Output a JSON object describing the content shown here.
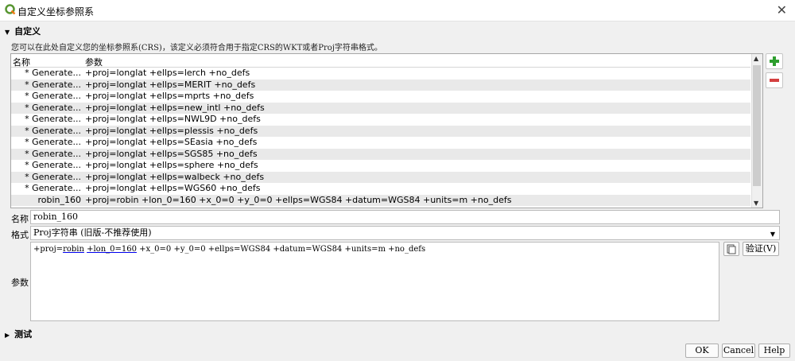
{
  "window": {
    "title": "自定义坐标参照系",
    "close_icon": "close-icon"
  },
  "section": {
    "label": "自定义",
    "description": "您可以在此处自定义您的坐标参照系(CRS)，该定义必须符合用于指定CRS的WKT或者Proj字符串格式。"
  },
  "table": {
    "headers": {
      "name": "名称",
      "params": "参数"
    },
    "rows": [
      {
        "name": "* Generate...",
        "params": "+proj=longlat +ellps=lerch +no_defs"
      },
      {
        "name": "* Generate...",
        "params": "+proj=longlat +ellps=MERIT +no_defs"
      },
      {
        "name": "* Generate...",
        "params": "+proj=longlat +ellps=mprts +no_defs"
      },
      {
        "name": "* Generate...",
        "params": "+proj=longlat +ellps=new_intl +no_defs"
      },
      {
        "name": "* Generate...",
        "params": "+proj=longlat +ellps=NWL9D +no_defs"
      },
      {
        "name": "* Generate...",
        "params": "+proj=longlat +ellps=plessis +no_defs"
      },
      {
        "name": "* Generate...",
        "params": "+proj=longlat +ellps=SEasia +no_defs"
      },
      {
        "name": "* Generate...",
        "params": "+proj=longlat +ellps=SGS85 +no_defs"
      },
      {
        "name": "* Generate...",
        "params": "+proj=longlat +ellps=sphere +no_defs"
      },
      {
        "name": "* Generate...",
        "params": "+proj=longlat +ellps=walbeck +no_defs"
      },
      {
        "name": "* Generate...",
        "params": "+proj=longlat +ellps=WGS60 +no_defs"
      },
      {
        "name": "robin_160",
        "params": "+proj=robin +lon_0=160 +x_0=0 +y_0=0 +ellps=WGS84 +datum=WGS84 +units=m +no_defs"
      }
    ]
  },
  "form": {
    "name_label": "名称",
    "name_value": "robin_160",
    "format_label": "格式",
    "format_value": "Proj字符串 (旧版-不推荐使用)",
    "params_label": "参数",
    "params_part1": "+proj=",
    "params_part2": "robin",
    "params_part3": " ",
    "params_part4": "+lon_0=160",
    "params_part5": " +x_0=0 +y_0=0 +ellps=WGS84 +datum=WGS84 +units=m +no_defs",
    "validate_label": "验证(V)"
  },
  "test_section": {
    "label": "测试"
  },
  "buttons": {
    "ok": "OK",
    "cancel": "Cancel",
    "help": "Help"
  },
  "colors": {
    "add_green": "#2e9e2e",
    "remove_red": "#d43f3f",
    "logo_green": "#589632"
  }
}
